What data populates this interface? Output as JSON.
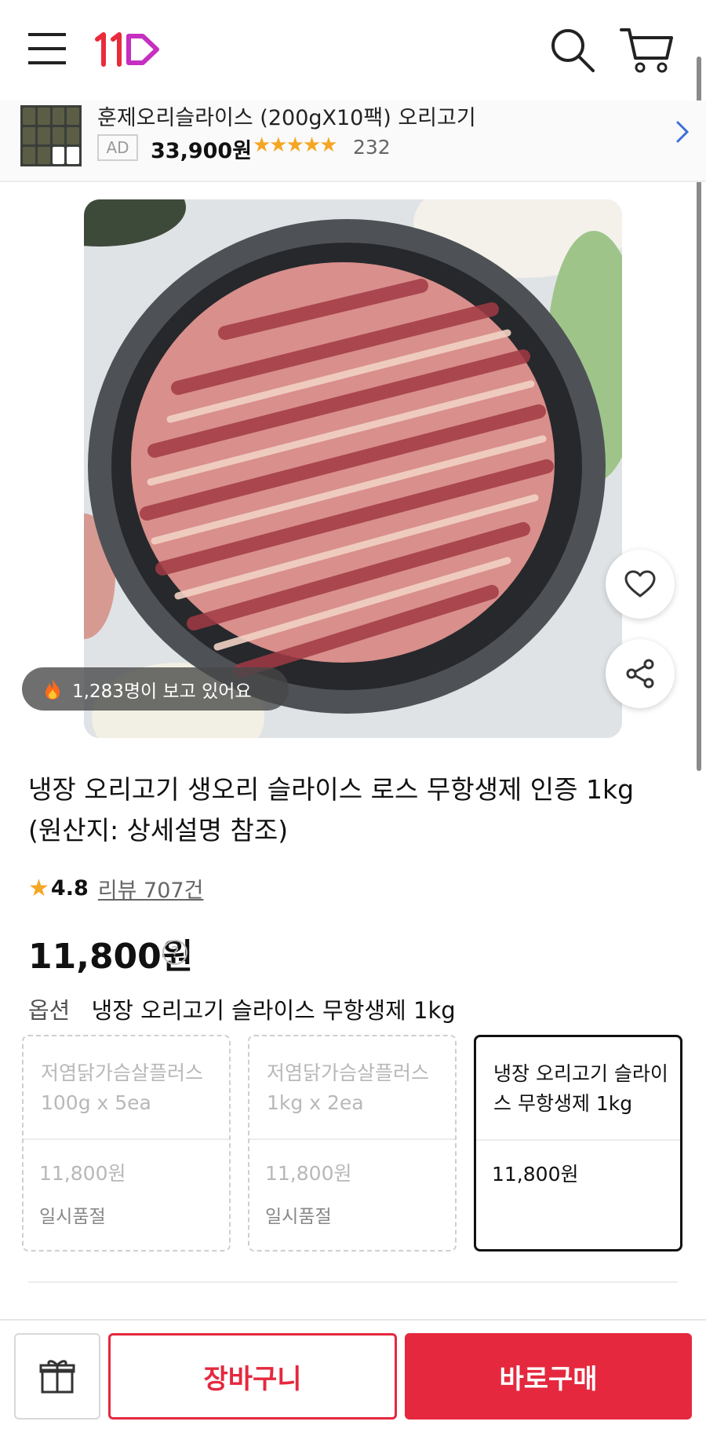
{
  "header": {
    "logo_text": "11st",
    "icons": [
      "menu-icon",
      "search-icon",
      "cart-icon"
    ]
  },
  "ad": {
    "title": "훈제오리슬라이스 (200gX10팩) 오리고기",
    "badge": "AD",
    "price": "33,900원",
    "stars": "★★★★★",
    "rating_fraction": 0.9,
    "review_count": "232"
  },
  "product": {
    "viewers": "1,283명이 보고 있어요",
    "title": "냉장 오리고기 생오리 슬라이스 로스 무항생제 인증 1kg (원산지: 상세설명 참조)",
    "rating_star": "★",
    "rating_score": "4.8",
    "review_link": "리뷰 707건",
    "price": "11,800원",
    "price_help": "?"
  },
  "options": {
    "label": "옵션",
    "selected_value": "냉장 오리고기 슬라이스 무항생제 1kg",
    "cards": [
      {
        "name": "저염닭가슴살플러스 100g x 5ea",
        "price": "11,800원",
        "status": "일시품절"
      },
      {
        "name": "저염닭가슴살플러스 1kg x 2ea",
        "price": "11,800원",
        "status": "일시품절"
      },
      {
        "name": "냉장 오리고기 슬라이스 무항생제 1kg",
        "price": "11,800원",
        "status": ""
      }
    ]
  },
  "bottom_bar": {
    "cart_label": "장바구니",
    "buy_label": "바로구매"
  },
  "colors": {
    "brand_red": "#e5283e",
    "star_yellow": "#f5a623"
  }
}
